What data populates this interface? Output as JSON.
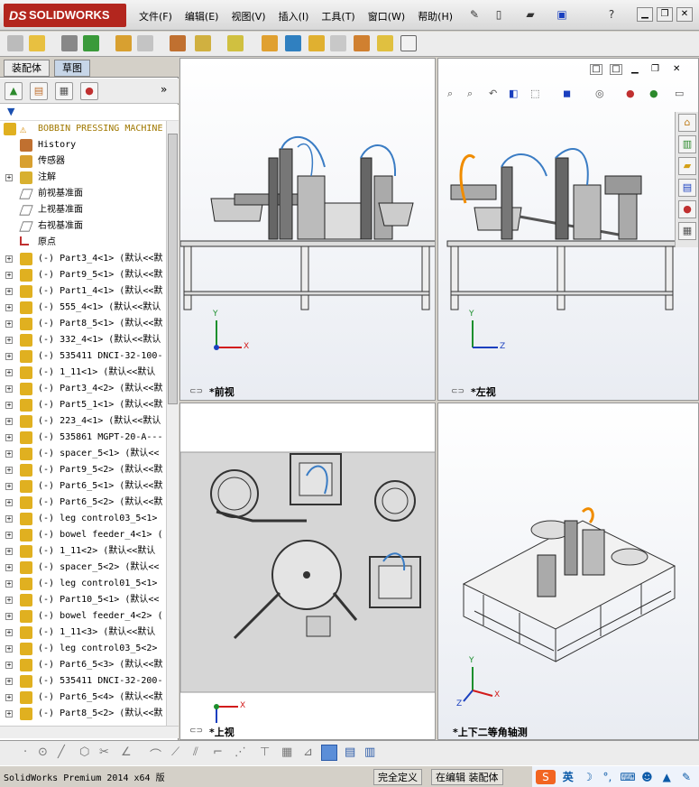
{
  "app": {
    "logo_prefix": "DS",
    "logo_name": "SOLIDWORKS"
  },
  "menu": [
    "文件(F)",
    "编辑(E)",
    "视图(V)",
    "插入(I)",
    "工具(T)",
    "窗口(W)",
    "帮助(H)"
  ],
  "panel_tabs": [
    "装配体",
    "草图"
  ],
  "tree": {
    "root": "BOBBIN PRESSING MACHINE",
    "items": [
      {
        "label": "History",
        "type": "history",
        "expand": false
      },
      {
        "label": "传感器",
        "type": "sensor",
        "expand": false
      },
      {
        "label": "注解",
        "type": "annotation",
        "expand": true
      },
      {
        "label": "前视基准面",
        "type": "plane",
        "expand": false
      },
      {
        "label": "上视基准面",
        "type": "plane",
        "expand": false
      },
      {
        "label": "右视基准面",
        "type": "plane",
        "expand": false
      },
      {
        "label": "原点",
        "type": "origin",
        "expand": false
      },
      {
        "label": "(-) Part3_4<1> (默认<<默",
        "type": "part",
        "expand": true
      },
      {
        "label": "(-) Part9_5<1> (默认<<默",
        "type": "part",
        "expand": true
      },
      {
        "label": "(-) Part1_4<1> (默认<<默",
        "type": "part",
        "expand": true
      },
      {
        "label": "(-) 555_4<1> (默认<<默认",
        "type": "part",
        "expand": true
      },
      {
        "label": "(-) Part8_5<1> (默认<<默",
        "type": "part",
        "expand": true
      },
      {
        "label": "(-) 332_4<1> (默认<<默认",
        "type": "part",
        "expand": true
      },
      {
        "label": "(-) 535411 DNCI-32-100-",
        "type": "part",
        "expand": true
      },
      {
        "label": "(-) 1_11<1> (默认<<默认",
        "type": "part",
        "expand": true
      },
      {
        "label": "(-) Part3_4<2> (默认<<默",
        "type": "part",
        "expand": true
      },
      {
        "label": "(-) Part5_1<1> (默认<<默",
        "type": "part",
        "expand": true
      },
      {
        "label": "(-) 223_4<1> (默认<<默认",
        "type": "part",
        "expand": true
      },
      {
        "label": "(-) 535861 MGPT-20-A---",
        "type": "part",
        "expand": true
      },
      {
        "label": "(-) spacer_5<1> (默认<<",
        "type": "part",
        "expand": true
      },
      {
        "label": "(-) Part9_5<2> (默认<<默",
        "type": "part",
        "expand": true
      },
      {
        "label": "(-) Part6_5<1> (默认<<默",
        "type": "part",
        "expand": true
      },
      {
        "label": "(-) Part6_5<2> (默认<<默",
        "type": "part",
        "expand": true
      },
      {
        "label": "(-) leg control03_5<1>",
        "type": "part",
        "expand": true
      },
      {
        "label": "(-) bowel feeder_4<1> (",
        "type": "part",
        "expand": true
      },
      {
        "label": "(-) 1_11<2> (默认<<默认",
        "type": "part",
        "expand": true
      },
      {
        "label": "(-) spacer_5<2> (默认<<",
        "type": "part",
        "expand": true
      },
      {
        "label": "(-) leg control01_5<1>",
        "type": "part",
        "expand": true
      },
      {
        "label": "(-) Part10_5<1> (默认<<",
        "type": "part",
        "expand": true
      },
      {
        "label": "(-) bowel feeder_4<2> (",
        "type": "part",
        "expand": true
      },
      {
        "label": "(-) 1_11<3> (默认<<默认",
        "type": "part",
        "expand": true
      },
      {
        "label": "(-) leg control03_5<2>",
        "type": "part",
        "expand": true
      },
      {
        "label": "(-) Part6_5<3> (默认<<默",
        "type": "part",
        "expand": true
      },
      {
        "label": "(-) 535411 DNCI-32-200-",
        "type": "part",
        "expand": true
      },
      {
        "label": "(-) Part6_5<4> (默认<<默",
        "type": "part",
        "expand": true
      },
      {
        "label": "(-) Part8_5<2> (默认<<默",
        "type": "part",
        "expand": true
      }
    ]
  },
  "viewports": {
    "front": {
      "label": "*前视"
    },
    "left": {
      "label": "*左视"
    },
    "top": {
      "label": "*上视"
    },
    "iso": {
      "label": "*上下二等角轴测"
    }
  },
  "axes": {
    "x": "X",
    "y": "Y",
    "z": "Z"
  },
  "status": {
    "product": "SolidWorks Premium 2014 x64 版",
    "defined": "完全定义",
    "editing": "在编辑 装配体",
    "ime": "英"
  },
  "colors": {
    "accent_red": "#b3261e",
    "highlight_orange": "#f08c00",
    "axis_green": "#1c8f2d",
    "axis_red": "#d21b1b",
    "axis_blue": "#1a3fbf"
  }
}
